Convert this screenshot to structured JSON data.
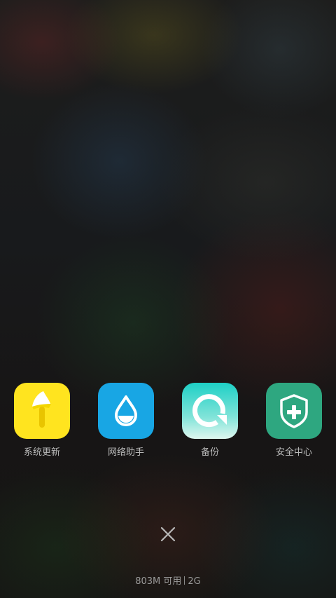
{
  "recent_apps": [
    {
      "label": "系统更新",
      "icon": "system-update-icon",
      "color": "#FFE620"
    },
    {
      "label": "网络助手",
      "icon": "network-assistant-icon",
      "color": "#1AA8E6"
    },
    {
      "label": "备份",
      "icon": "backup-icon",
      "color": "#19C8C0"
    },
    {
      "label": "安全中心",
      "icon": "security-center-icon",
      "color": "#2FA882"
    }
  ],
  "close": {
    "icon": "close-icon"
  },
  "memory": {
    "available": "803M 可用",
    "total": "2G"
  }
}
